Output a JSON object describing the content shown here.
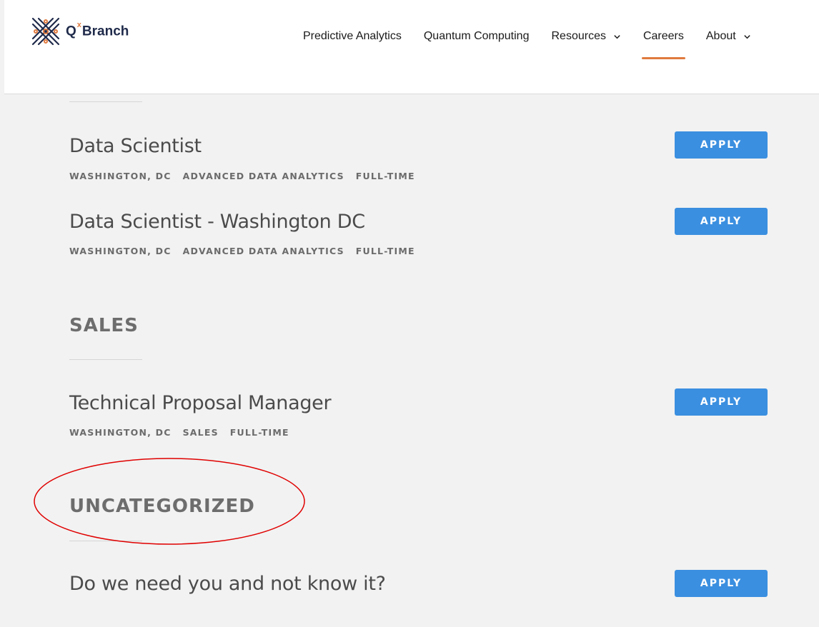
{
  "brand": {
    "name_q": "Q",
    "name_x": "x",
    "name_rest": "Branch",
    "accent": "#e07a3f",
    "navy": "#1f2a4a"
  },
  "nav": {
    "items": [
      {
        "label": "Predictive Analytics",
        "dropdown": false
      },
      {
        "label": "Quantum Computing",
        "dropdown": false
      },
      {
        "label": "Resources",
        "dropdown": true
      },
      {
        "label": "Careers",
        "dropdown": false,
        "active": true
      },
      {
        "label": "About",
        "dropdown": true
      }
    ]
  },
  "jobs": {
    "apply_label": "APPLY",
    "apply_color": "#3b8fe0",
    "j1": {
      "title": "Data Scientist",
      "meta": [
        "WASHINGTON, DC",
        "ADVANCED DATA ANALYTICS",
        "FULL-TIME"
      ]
    },
    "j2": {
      "title": "Data Scientist - Washington DC",
      "meta": [
        "WASHINGTON, DC",
        "ADVANCED DATA ANALYTICS",
        "FULL-TIME"
      ]
    },
    "j3": {
      "title": "Technical Proposal Manager",
      "meta": [
        "WASHINGTON, DC",
        "SALES",
        "FULL-TIME"
      ]
    },
    "j4": {
      "title": "Do we need you and not know it?"
    }
  },
  "sections": {
    "sales": "SALES",
    "uncategorized": "UNCATEGORIZED"
  },
  "annotation": {
    "shape": "ellipse",
    "color": "#e00000",
    "target": "uncategorized-heading"
  }
}
